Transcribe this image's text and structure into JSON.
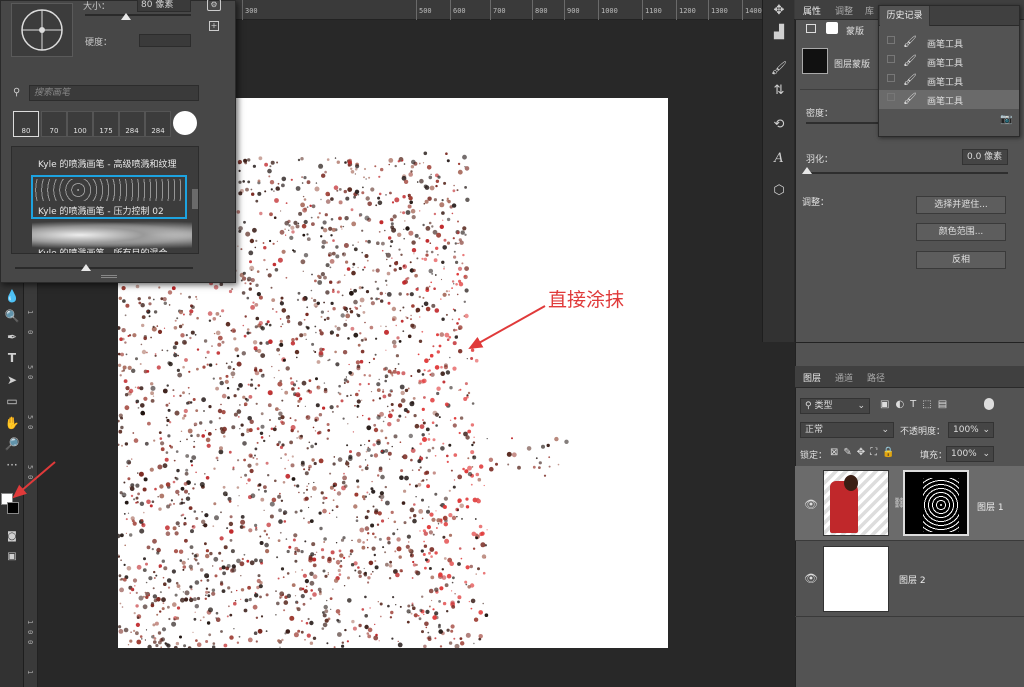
{
  "ruler_top": {
    "labels": [
      "300",
      "500",
      "600",
      "700",
      "800",
      "900",
      "1000",
      "1100",
      "1200",
      "1300",
      "1400"
    ]
  },
  "ruler_left": {
    "labels": [
      "1",
      "0",
      "5",
      "0",
      "5",
      "0",
      "5",
      "0",
      "1",
      "0",
      "0",
      "1"
    ]
  },
  "brush_popup": {
    "size_label": "大小：",
    "size_value": "80 像素",
    "hardness_label": "硬度：",
    "search_placeholder": "搜索画笔",
    "presets": [
      {
        "size": "80"
      },
      {
        "size": "70"
      },
      {
        "size": "100"
      },
      {
        "size": "175"
      },
      {
        "size": "284"
      },
      {
        "size": "284"
      },
      {
        "size": ""
      }
    ],
    "brushes": [
      "Kyle 的喷溅画笔 - 高级喷溅和纹理",
      "Kyle 的喷溅画笔 - 压力控制 02",
      "Kyle 的喷溅画笔 - 所有目的混合"
    ]
  },
  "annotation": {
    "text": "直接涂抹",
    "color": "#e03a3a"
  },
  "properties": {
    "tabs": [
      "属性",
      "调整",
      "库"
    ],
    "mask_labels": [
      "蒙版",
      "图层蒙版"
    ],
    "density_label": "密度：",
    "feather_label": "羽化：",
    "feather_value": "0.0 像素",
    "adjust_label": "调整：",
    "buttons": [
      "选择并遮住...",
      "颜色范围...",
      "反相"
    ]
  },
  "history": {
    "title": "历史记录",
    "items": [
      "画笔工具",
      "画笔工具",
      "画笔工具",
      "画笔工具"
    ],
    "selected_index": 3
  },
  "layers": {
    "tabs": [
      "图层",
      "通道",
      "路径"
    ],
    "filter_type": "类型",
    "blend_mode": "正常",
    "opacity_label": "不透明度：",
    "opacity_value": "100%",
    "lock_label": "锁定：",
    "fill_label": "填充：",
    "fill_value": "100%",
    "items": [
      {
        "name": "图层 1",
        "selected": true
      },
      {
        "name": "图层 2",
        "selected": false
      }
    ]
  },
  "colors": {
    "accent_selection": "#1da3e0",
    "annotation_red": "#e03a3a"
  }
}
